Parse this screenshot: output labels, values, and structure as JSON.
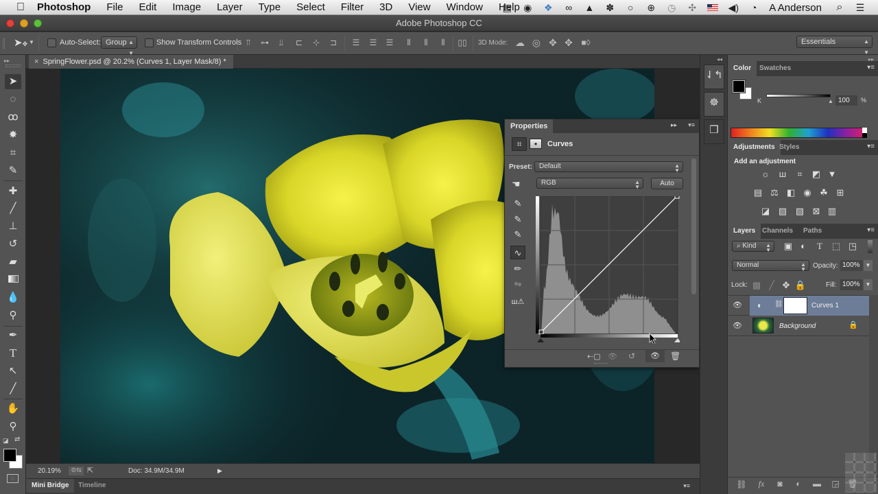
{
  "menubar": {
    "apple_icon": "apple-logo-icon",
    "app_name": "Photoshop",
    "items": [
      "File",
      "Edit",
      "Image",
      "Layer",
      "Type",
      "Select",
      "Filter",
      "3D",
      "View",
      "Window",
      "Help"
    ],
    "status_icons": [
      "film-icon",
      "knob-icon",
      "dropbox-icon",
      "creative-cloud-icon",
      "bell-icon",
      "paw-icon",
      "chat-bubble-icon",
      "accessibility-icon",
      "time-machine-icon",
      "bluetooth-icon",
      "flag-us-icon",
      "volume-icon",
      "clock-icon"
    ],
    "user": "A Anderson",
    "search_icon": "spotlight-icon",
    "list_icon": "notification-center-icon"
  },
  "window": {
    "title": "Adobe Photoshop CC"
  },
  "options_bar": {
    "auto_select_label": "Auto-Select:",
    "auto_select_checked": false,
    "auto_select_target": "Group",
    "show_transform_label": "Show Transform Controls",
    "show_transform_checked": false,
    "three_d_mode_label": "3D Mode:",
    "workspace": "Essentials"
  },
  "document": {
    "tab_title": "SpringFlower.psd @ 20.2% (Curves 1, Layer Mask/8) *",
    "zoom": "20.19%",
    "doc_size": "Doc: 34.9M/34.9M"
  },
  "bottom_tabs": [
    "Mini Bridge",
    "Timeline"
  ],
  "properties": {
    "title": "Properties",
    "adjustment_name": "Curves",
    "preset_label": "Preset:",
    "preset_value": "Default",
    "channel_value": "RGB",
    "auto_button": "Auto",
    "curve_points": [
      [
        0,
        0
      ],
      [
        255,
        255
      ]
    ],
    "histogram_note": "luminance histogram peak in shadows, secondary hump in highlights"
  },
  "color_panel": {
    "tabs": [
      "Color",
      "Swatches"
    ],
    "channel_label": "K",
    "value": "100",
    "unit": "%",
    "foreground": "#000000",
    "background": "#ffffff"
  },
  "adjustments_panel": {
    "tabs": [
      "Adjustments",
      "Styles"
    ],
    "heading": "Add an adjustment",
    "row1": [
      "brightness-contrast-icon",
      "levels-icon",
      "curves-icon",
      "exposure-icon",
      "vibrance-icon"
    ],
    "row2": [
      "hue-saturation-icon",
      "color-balance-icon",
      "black-white-icon",
      "photo-filter-icon",
      "channel-mixer-icon",
      "color-lookup-icon"
    ],
    "row3": [
      "invert-icon",
      "posterize-icon",
      "threshold-icon",
      "selective-color-icon",
      "gradient-map-icon"
    ]
  },
  "layers_panel": {
    "tabs": [
      "Layers",
      "Channels",
      "Paths"
    ],
    "filter_label": "Kind",
    "blend_mode": "Normal",
    "opacity_label": "Opacity:",
    "opacity": "100%",
    "lock_label": "Lock:",
    "fill_label": "Fill:",
    "fill": "100%",
    "layers": [
      {
        "name": "Curves 1",
        "visible": true,
        "selected": true,
        "type": "adjustment"
      },
      {
        "name": "Background",
        "visible": true,
        "selected": false,
        "type": "image",
        "locked": true
      }
    ]
  },
  "glyphs": {
    "move": "⇲",
    "chev": "▾",
    "updown": "⇕",
    "eye": "👁",
    "lock": "🔒",
    "link": "⛓",
    "trash": "🗑",
    "play": "▶",
    "collapse": "◂◂",
    "expand": "▸▸",
    "menu": "▾≡",
    "close": "×"
  }
}
